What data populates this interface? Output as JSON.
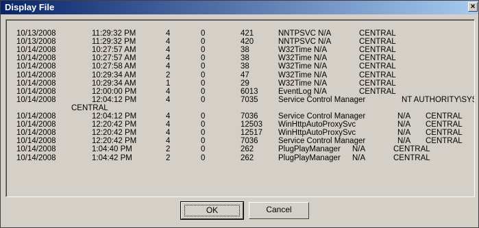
{
  "window": {
    "title": "Display File",
    "close_glyph": "×"
  },
  "log": {
    "rows": [
      {
        "date": "10/13/2008",
        "time": "11:29:32 PM",
        "n1": "4",
        "n2": "0",
        "id": "421",
        "source": "NNTPSVC N/A",
        "computer": "CENTRAL"
      },
      {
        "date": "10/13/2008",
        "time": "11:29:32 PM",
        "n1": "4",
        "n2": "0",
        "id": "420",
        "source": "NNTPSVC N/A",
        "computer": "CENTRAL"
      },
      {
        "date": "10/14/2008",
        "time": "10:27:57 AM",
        "n1": "4",
        "n2": "0",
        "id": "38",
        "source": "W32Time N/A",
        "computer": "CENTRAL"
      },
      {
        "date": "10/14/2008",
        "time": "10:27:57 AM",
        "n1": "4",
        "n2": "0",
        "id": "38",
        "source": "W32Time N/A",
        "computer": "CENTRAL"
      },
      {
        "date": "10/14/2008",
        "time": "10:27:58 AM",
        "n1": "4",
        "n2": "0",
        "id": "38",
        "source": "W32Time N/A",
        "computer": "CENTRAL"
      },
      {
        "date": "10/14/2008",
        "time": "10:29:34 AM",
        "n1": "2",
        "n2": "0",
        "id": "47",
        "source": "W32Time N/A",
        "computer": "CENTRAL"
      },
      {
        "date": "10/14/2008",
        "time": "10:29:34 AM",
        "n1": "1",
        "n2": "0",
        "id": "29",
        "source": "W32Time N/A",
        "computer": "CENTRAL"
      },
      {
        "date": "10/14/2008",
        "time": "12:00:00 PM",
        "n1": "4",
        "n2": "0",
        "id": "6013",
        "source": "EventLog N/A",
        "computer": "CENTRAL"
      },
      {
        "date": "10/14/2008",
        "time": "12:04:12 PM",
        "n1": "4",
        "n2": "0",
        "id": "7035",
        "source": "Service Control Manager",
        "user": "NT AUTHORITY\\SYSTEM"
      },
      {
        "wrap": "CENTRAL"
      },
      {
        "date": "10/14/2008",
        "time": "12:04:12 PM",
        "n1": "4",
        "n2": "0",
        "id": "7036",
        "source": "Service Control Manager",
        "user": "N/A",
        "computer": "CENTRAL"
      },
      {
        "date": "10/14/2008",
        "time": "12:20:42 PM",
        "n1": "4",
        "n2": "0",
        "id": "12503",
        "source": "WinHttpAutoProxySvc",
        "user": "N/A",
        "computer": "CENTRAL"
      },
      {
        "date": "10/14/2008",
        "time": "12:20:42 PM",
        "n1": "4",
        "n2": "0",
        "id": "12517",
        "source": "WinHttpAutoProxySvc",
        "user": "N/A",
        "computer": "CENTRAL"
      },
      {
        "date": "10/14/2008",
        "time": "12:20:42 PM",
        "n1": "4",
        "n2": "0",
        "id": "7036",
        "source": "Service Control Manager",
        "user": "N/A",
        "computer": "CENTRAL"
      },
      {
        "date": "10/14/2008",
        "time": "1:04:40 PM",
        "n1": "2",
        "n2": "0",
        "id": "262",
        "source": "PlugPlayManager",
        "user": "N/A",
        "computer": "CENTRAL"
      },
      {
        "date": "10/14/2008",
        "time": "1:04:42 PM",
        "n1": "2",
        "n2": "0",
        "id": "262",
        "source": "PlugPlayManager",
        "user": "N/A",
        "computer": "CENTRAL"
      }
    ]
  },
  "buttons": {
    "ok_label": "OK",
    "cancel_label": "Cancel"
  }
}
